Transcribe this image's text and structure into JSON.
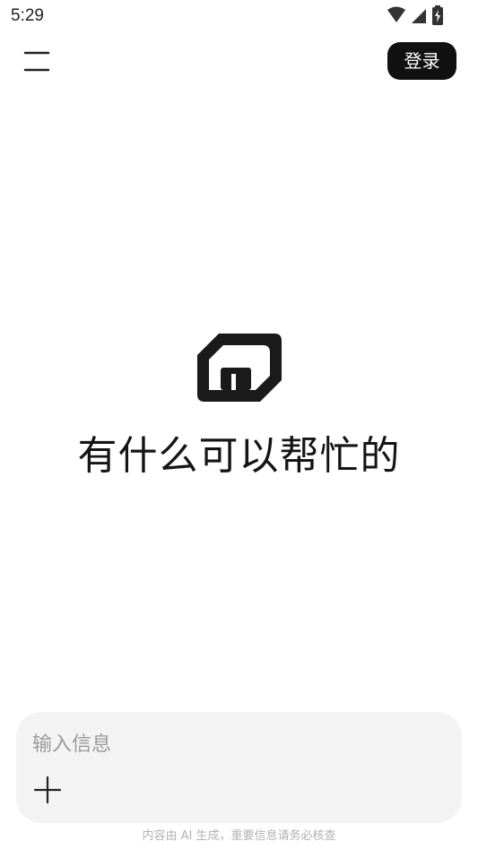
{
  "status_bar": {
    "time": "5:29",
    "icons": [
      "wifi-icon",
      "cellular-signal-icon",
      "battery-charging-icon"
    ]
  },
  "header": {
    "menu_icon": "menu-icon",
    "login_label": "登录"
  },
  "hero": {
    "logo_icon": "app-logo-icon",
    "headline": "有什么可以帮忙的"
  },
  "composer": {
    "placeholder": "输入信息",
    "value": "",
    "add_icon": "plus-icon"
  },
  "footer": {
    "disclaimer": "内容由 AI 生成，重要信息请务必核查"
  },
  "colors": {
    "background": "#ffffff",
    "primary": "#111111",
    "composer_bg": "#f3f3f3",
    "placeholder": "#9a9a9a",
    "disclaimer": "#b2b2b2"
  }
}
